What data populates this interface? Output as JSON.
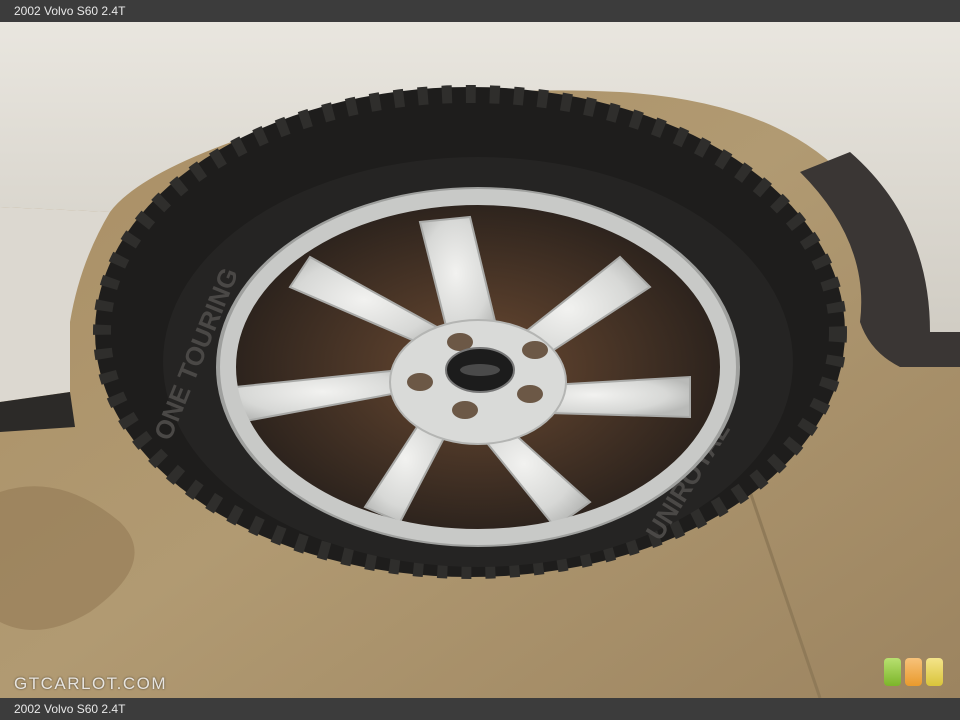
{
  "header": {
    "title": "2002 Volvo S60 2.4T"
  },
  "footer": {
    "caption": "2002 Volvo S60 2.4T"
  },
  "watermark": {
    "text": "GTCARLOT.COM"
  },
  "photo": {
    "subject": "wheel-tire",
    "tire_sidewall_text": "UNIROYAL",
    "tire_model_text": "ONE TOURING"
  },
  "badges": {
    "colors": [
      "#8cc63f",
      "#f0a840",
      "#e6d35a"
    ]
  },
  "colors": {
    "bar": "#3c3c3c",
    "text": "#e8e8e8"
  }
}
